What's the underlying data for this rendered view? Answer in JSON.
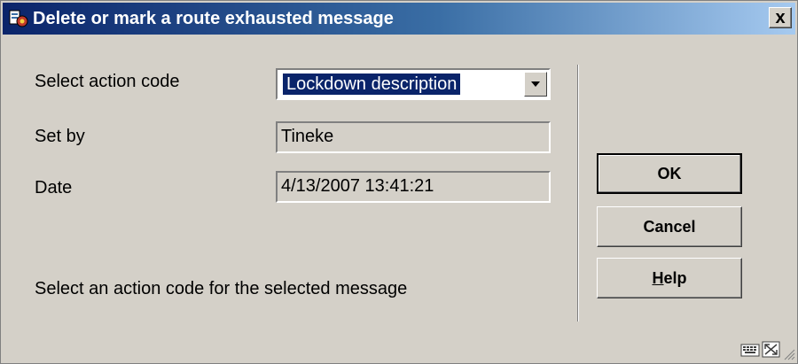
{
  "window": {
    "title": "Delete or mark a route exhausted message",
    "close_label": "x"
  },
  "form": {
    "action_code_label": "Select action code",
    "action_code_value": "Lockdown description",
    "set_by_label": "Set by",
    "set_by_value": "Tineke",
    "date_label": "Date",
    "date_value": "4/13/2007 13:41:21",
    "hint": "Select an action code for the selected message"
  },
  "buttons": {
    "ok": "OK",
    "cancel": "Cancel",
    "help_mnemonic": "H",
    "help_rest": "elp"
  },
  "colors": {
    "title_bar_start": "#0a246a",
    "title_bar_end": "#a6caf0",
    "dialog_bg": "#d4d0c8",
    "selection": "#0a246a"
  },
  "icons": {
    "app": "app-icon",
    "dropdown": "chevron-down-icon",
    "status1": "keyboard-icon",
    "status2": "resize-icon",
    "grip": "size-grip-icon"
  }
}
